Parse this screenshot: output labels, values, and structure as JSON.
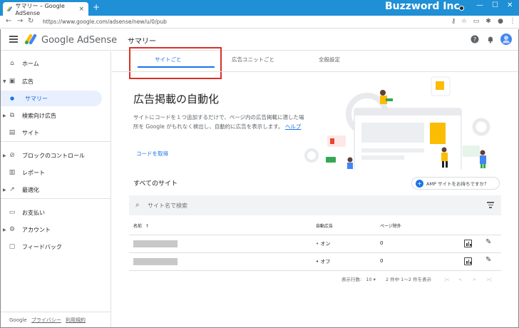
{
  "browser": {
    "tab_title": "サマリー – Google AdSense",
    "tab_close": "×",
    "new_tab": "+",
    "brand": "Buzzword Inc.",
    "url": "https://www.google.com/adsense/new/u/0/pub"
  },
  "app": {
    "product_name": "Google AdSense",
    "page_title": "サマリー"
  },
  "sidebar": {
    "items": [
      {
        "label": "ホーム"
      },
      {
        "label": "広告"
      },
      {
        "label": "サマリー"
      },
      {
        "label": "検索向け広告"
      },
      {
        "label": "サイト"
      },
      {
        "label": "ブロックのコントロール"
      },
      {
        "label": "レポート"
      },
      {
        "label": "最適化"
      },
      {
        "label": "お支払い"
      },
      {
        "label": "アカウント"
      },
      {
        "label": "フィードバック"
      }
    ],
    "footer": {
      "google": "Google",
      "privacy": "プライバシー",
      "terms": "利用規約"
    }
  },
  "tabs": [
    {
      "label": "サイトごと"
    },
    {
      "label": "広告ユニットごと"
    },
    {
      "label": "全般設定"
    }
  ],
  "hero": {
    "title": "広告掲載の自動化",
    "desc": "サイトにコードを１つ追加するだけで、ページ内の広告掲載に適した場所を Google がもれなく検出し、自動的に広告を表示します。",
    "help": "ヘルプ",
    "code_link": "コードを取得"
  },
  "sites": {
    "title": "すべてのサイト",
    "amp_button": "AMP サイトをお持ちですか？",
    "search_placeholder": "サイト名で検索",
    "columns": {
      "name": "名前",
      "name_sort": "↑",
      "auto_ads": "自動広告",
      "page_exclusions": "ページ除外"
    },
    "rows": [
      {
        "status": "オン",
        "exclusions": "0"
      },
      {
        "status": "オフ",
        "exclusions": "0"
      }
    ]
  },
  "pager": {
    "rows_label": "表示行数:",
    "rows_value": "10",
    "range": "2 件中 1〜2 件を表示"
  },
  "colors": {
    "titlebar": "#1f8fd6",
    "accent": "#1a73e8",
    "highlight_box": "#d93025",
    "status_on": "#188038"
  }
}
